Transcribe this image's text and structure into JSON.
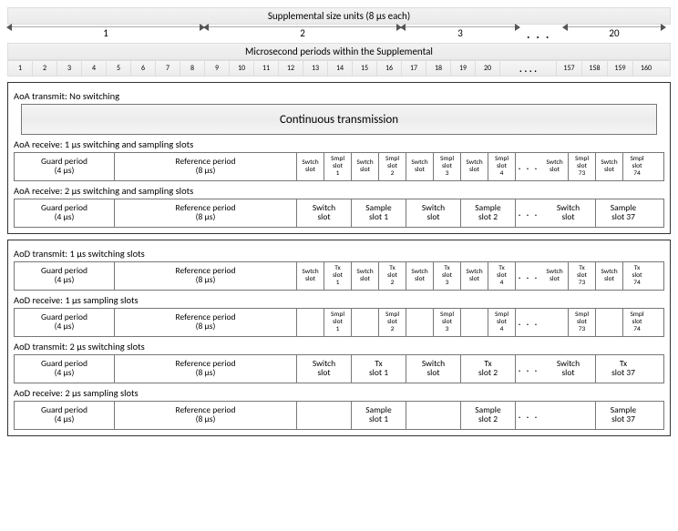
{
  "header": {
    "supplemental_title": "Supplemental size units (8 µs each)",
    "microsecond_title": "Microsecond periods within the Supplemental"
  },
  "unit_scale": {
    "segments": [
      "1",
      "2",
      "3"
    ],
    "last": "20",
    "ellipsis": ". . ."
  },
  "micro_scale": {
    "ticks_a": [
      "1",
      "2",
      "3",
      "4",
      "5",
      "6",
      "7",
      "8",
      "9",
      "10",
      "11",
      "12",
      "13",
      "14",
      "15",
      "16",
      "17",
      "18",
      "19",
      "20"
    ],
    "ticks_b": [
      "157",
      "158",
      "159",
      "160"
    ],
    "ellipsis": ". . . ."
  },
  "guard": {
    "l1": "Guard period",
    "l2": "(4 µs)"
  },
  "reference": {
    "l1": "Reference period",
    "l2": "(8 µs)"
  },
  "continuous": "Continuous transmission",
  "ellipsis": ". . .",
  "aoa": {
    "title_tx": "AoA transmit: No switching",
    "title_rx1": "AoA receive: 1 µs switching and sampling slots",
    "rx1_cells_a": [
      "Swtch slot",
      "Smpl slot 1",
      "Swtch slot",
      "Smpl slot 2",
      "Swtch slot",
      "Smpl slot 3",
      "Swtch slot",
      "Smpl slot 4"
    ],
    "rx1_cells_b": [
      "Swtch slot",
      "Smpl slot 73",
      "Swtch slot",
      "Smpl slot 74"
    ],
    "title_rx2": "AoA receive: 2 µs switching and sampling slots",
    "rx2_cells_a": [
      "Switch slot",
      "Sample slot 1",
      "Switch slot",
      "Sample slot 2"
    ],
    "rx2_cells_b": [
      "Switch slot",
      "Sample slot 37"
    ]
  },
  "aod": {
    "title_tx1": "AoD transmit: 1 µs switching slots",
    "tx1_cells_a": [
      "Swtch slot",
      "Tx slot 1",
      "Swtch slot",
      "Tx slot 2",
      "Swtch slot",
      "Tx slot 3",
      "Swtch slot",
      "Tx slot 4"
    ],
    "tx1_cells_b": [
      "Swtch slot",
      "Tx slot 73",
      "Swtch slot",
      "Tx slot 74"
    ],
    "title_rx1": "AoD receive: 1 µs sampling slots",
    "rx1_cells_a": [
      "",
      "Smpl slot 1",
      "",
      "Smpl slot 2",
      "",
      "Smpl slot 3",
      "",
      "Smpl slot 4"
    ],
    "rx1_cells_b": [
      "",
      "Smpl slot 73",
      "",
      "Smpl slot 74"
    ],
    "title_tx2": "AoD transmit: 2 µs switching slots",
    "tx2_cells_a": [
      "Switch slot",
      "Tx slot 1",
      "Switch slot",
      "Tx slot 2"
    ],
    "tx2_cells_b": [
      "Switch slot",
      "Tx slot 37"
    ],
    "title_rx2": "AoD receive: 2 µs sampling slots",
    "rx2_cells_a": [
      "",
      "Sample slot 1",
      "",
      "Sample slot 2"
    ],
    "rx2_cells_b": [
      "",
      "Sample slot 37"
    ]
  }
}
